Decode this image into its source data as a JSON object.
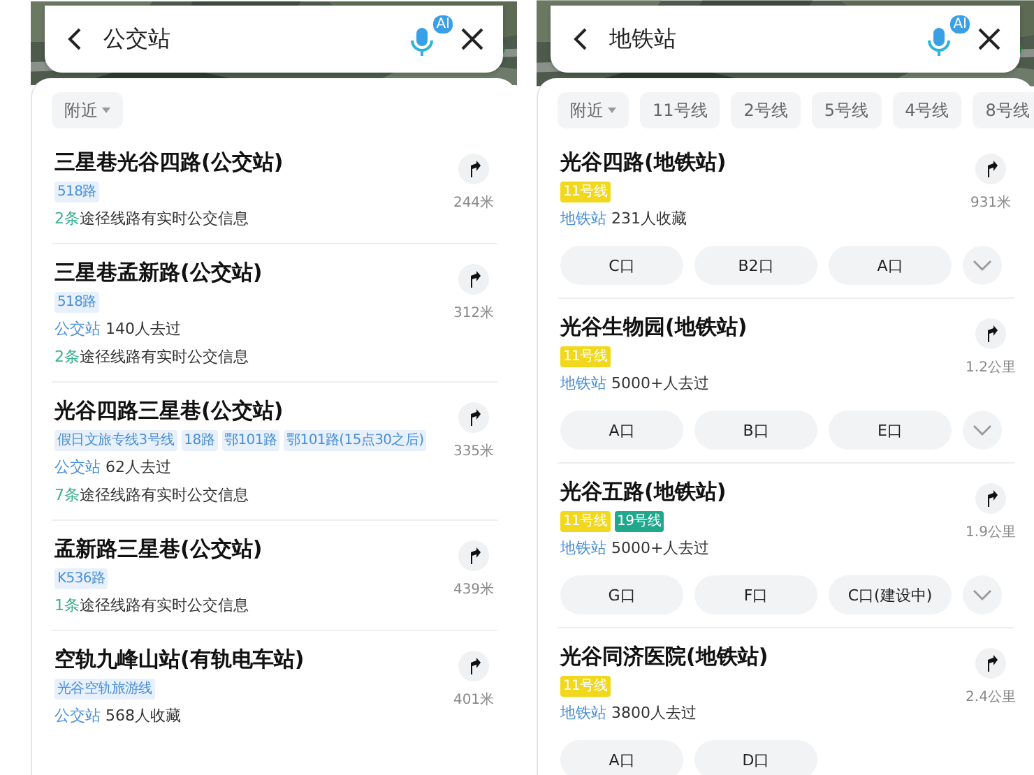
{
  "panels": [
    {
      "search": {
        "query": "公交站",
        "ai_badge": "AI"
      },
      "filters": [
        {
          "label": "附近",
          "dropdown": true
        }
      ],
      "results": [
        {
          "name": "三星巷光谷四路(公交站)",
          "distance": "244米",
          "tags": [
            {
              "label": "518路",
              "color": "#e8f1fb"
            }
          ],
          "lines": [
            {
              "kind": "realtime",
              "count": "2条",
              "text": "途径线路有实时公交信息"
            }
          ]
        },
        {
          "name": "三星巷孟新路(公交站)",
          "distance": "312米",
          "tags": [
            {
              "label": "518路",
              "color": "#e8f1fb"
            }
          ],
          "lines": [
            {
              "kind": "stat",
              "type": "公交站",
              "text": "140人去过"
            },
            {
              "kind": "realtime",
              "count": "2条",
              "text": "途径线路有实时公交信息"
            }
          ]
        },
        {
          "name": "光谷四路三星巷(公交站)",
          "distance": "335米",
          "tags": [
            {
              "label": "假日文旅专线3号线",
              "color": "#e8f1fb"
            },
            {
              "label": "18路",
              "color": "#e8f1fb"
            },
            {
              "label": "鄂101路",
              "color": "#e8f1fb"
            },
            {
              "label": "鄂101路(15点30之后)",
              "color": "#e8f1fb"
            }
          ],
          "lines": [
            {
              "kind": "stat",
              "type": "公交站",
              "text": "62人去过"
            },
            {
              "kind": "realtime",
              "count": "7条",
              "text": "途径线路有实时公交信息"
            }
          ]
        },
        {
          "name": "孟新路三星巷(公交站)",
          "distance": "439米",
          "tags": [
            {
              "label": "K536路",
              "color": "#e8f1fb"
            }
          ],
          "lines": [
            {
              "kind": "realtime",
              "count": "1条",
              "text": "途径线路有实时公交信息"
            }
          ]
        },
        {
          "name": "空轨九峰山站(有轨电车站)",
          "distance": "401米",
          "tags": [
            {
              "label": "光谷空轨旅游线",
              "color": "#e8f1fb"
            }
          ],
          "lines": [
            {
              "kind": "stat",
              "type": "公交站",
              "text": "568人收藏"
            }
          ]
        }
      ]
    },
    {
      "search": {
        "query": "地铁站",
        "ai_badge": "AI"
      },
      "filters": [
        {
          "label": "附近",
          "dropdown": true
        },
        {
          "label": "11号线",
          "dropdown": false
        },
        {
          "label": "2号线",
          "dropdown": false
        },
        {
          "label": "5号线",
          "dropdown": false
        },
        {
          "label": "4号线",
          "dropdown": false
        },
        {
          "label": "8号线",
          "dropdown": false
        }
      ],
      "results": [
        {
          "name": "光谷四路(地铁站)",
          "distance": "931米",
          "tags": [
            {
              "label": "11号线",
              "color": "#f2d81c"
            }
          ],
          "lines": [
            {
              "kind": "stat",
              "type": "地铁站",
              "text": "231人收藏"
            }
          ],
          "exits": {
            "items": [
              "C口",
              "B2口",
              "A口"
            ],
            "more_button": true
          }
        },
        {
          "name": "光谷生物园(地铁站)",
          "distance": "1.2公里",
          "tags": [
            {
              "label": "11号线",
              "color": "#f2d81c"
            }
          ],
          "lines": [
            {
              "kind": "stat",
              "type": "地铁站",
              "text": "5000+人去过"
            }
          ],
          "exits": {
            "items": [
              "A口",
              "B口",
              "E口"
            ],
            "more_button": true
          }
        },
        {
          "name": "光谷五路(地铁站)",
          "distance": "1.9公里",
          "tags": [
            {
              "label": "11号线",
              "color": "#f2d81c"
            },
            {
              "label": "19号线",
              "color": "#1fa88c"
            }
          ],
          "lines": [
            {
              "kind": "stat",
              "type": "地铁站",
              "text": "5000+人去过"
            }
          ],
          "exits": {
            "items": [
              "G口",
              "F口",
              "C口(建设中)"
            ],
            "more_button": true
          }
        },
        {
          "name": "光谷同济医院(地铁站)",
          "distance": "2.4公里",
          "tags": [
            {
              "label": "11号线",
              "color": "#f2d81c"
            }
          ],
          "lines": [
            {
              "kind": "stat",
              "type": "地铁站",
              "text": "3800人去过"
            }
          ],
          "exits": {
            "items": [
              "A口",
              "D口"
            ],
            "more_button": false
          }
        }
      ]
    }
  ]
}
